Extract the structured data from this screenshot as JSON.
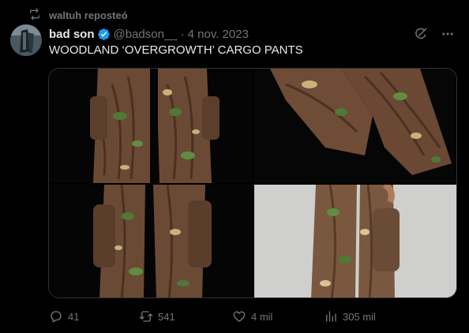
{
  "repost": {
    "text": "waltuh reposteó",
    "icon": "repost-icon"
  },
  "author": {
    "display_name": "bad son",
    "handle": "@badson__",
    "separator": "·",
    "date": "4 nov. 2023",
    "verified": true,
    "verified_color": "#1d9bf0"
  },
  "tweet": {
    "text": "WOODLAND ‘OVERGROWTH’ CARGO PANTS"
  },
  "header_actions": {
    "grok_icon": "grok-icon",
    "more_icon": "more-icon"
  },
  "media": {
    "images": [
      {
        "icon": "cargo-pants-front-photo"
      },
      {
        "icon": "cargo-pants-knee-detail-photo"
      },
      {
        "icon": "cargo-pants-pocket-detail-photo"
      },
      {
        "icon": "cargo-pants-worn-photo"
      }
    ]
  },
  "actions": {
    "replies": "41",
    "reposts": "541",
    "likes": "4 mil",
    "views": "305 mil"
  },
  "colors": {
    "background": "#000000",
    "text_primary": "#e7e9ea",
    "text_secondary": "#71767b",
    "border": "#2f3336",
    "accent": "#1d9bf0"
  }
}
